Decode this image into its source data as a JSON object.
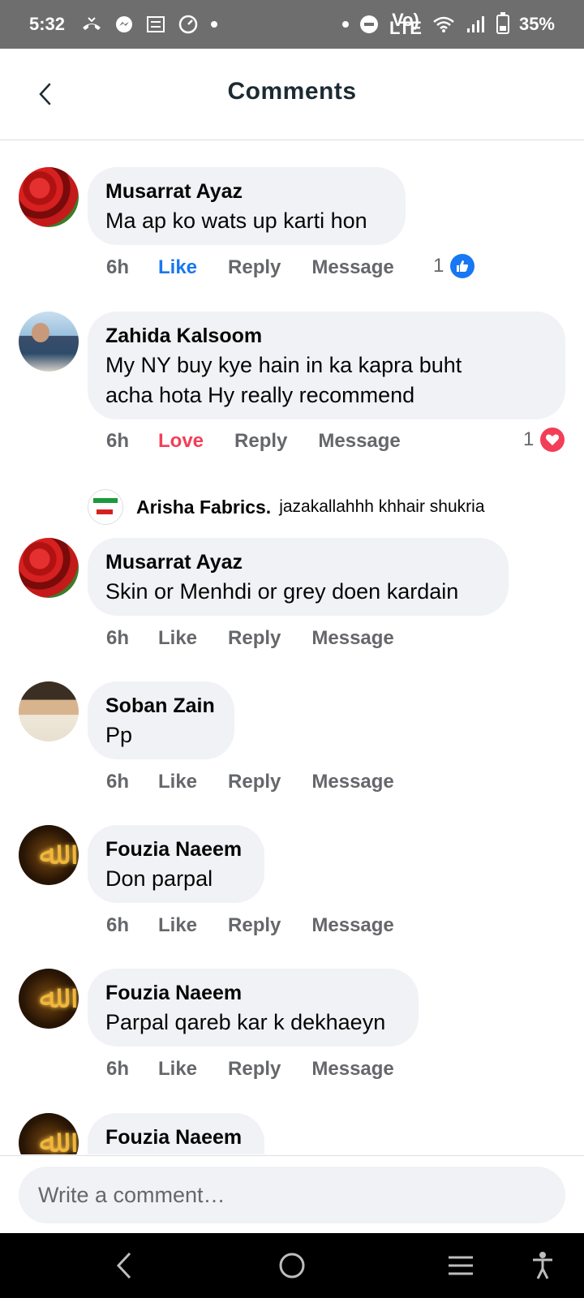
{
  "status_bar": {
    "time": "5:32",
    "battery": "35%",
    "volte": "Vo)) LTE"
  },
  "header": {
    "title": "Comments"
  },
  "comments": [
    {
      "name": "Musarrat Ayaz",
      "text": "Ma ap ko wats up karti hon",
      "time": "6h",
      "like": "Like",
      "reply": "Reply",
      "message": "Message",
      "reaction_count": "1",
      "reaction": "like"
    },
    {
      "name": "Zahida Kalsoom",
      "text_lines": [
        "My NY buy kye hain in ka kapra buht",
        "acha hota Hy really recommend"
      ],
      "time": "6h",
      "like": "Love",
      "reply": "Reply",
      "message": "Message",
      "reaction_count": "1",
      "reaction": "love"
    },
    {
      "name": "Musarrat Ayaz",
      "text": "Skin or Menhdi or grey doen kardain",
      "time": "6h",
      "like": "Like",
      "reply": "Reply",
      "message": "Message"
    },
    {
      "name": "Soban Zain",
      "text": "Pp",
      "time": "6h",
      "like": "Like",
      "reply": "Reply",
      "message": "Message"
    },
    {
      "name": "Fouzia Naeem",
      "text": "Don parpal",
      "time": "6h",
      "like": "Like",
      "reply": "Reply",
      "message": "Message"
    },
    {
      "name": "Fouzia Naeem",
      "text": "Parpal qareb kar k dekhaeyn",
      "time": "6h",
      "like": "Like",
      "reply": "Reply",
      "message": "Message"
    },
    {
      "name": "Fouzia Naeem"
    }
  ],
  "reply_preview": {
    "name": "Arisha Fabrics.",
    "text": "jazakallahhh khhair shukria"
  },
  "composer": {
    "placeholder": "Write a comment…"
  },
  "icons": {
    "accent_like": "#1877f2",
    "accent_love": "#f33e58"
  }
}
